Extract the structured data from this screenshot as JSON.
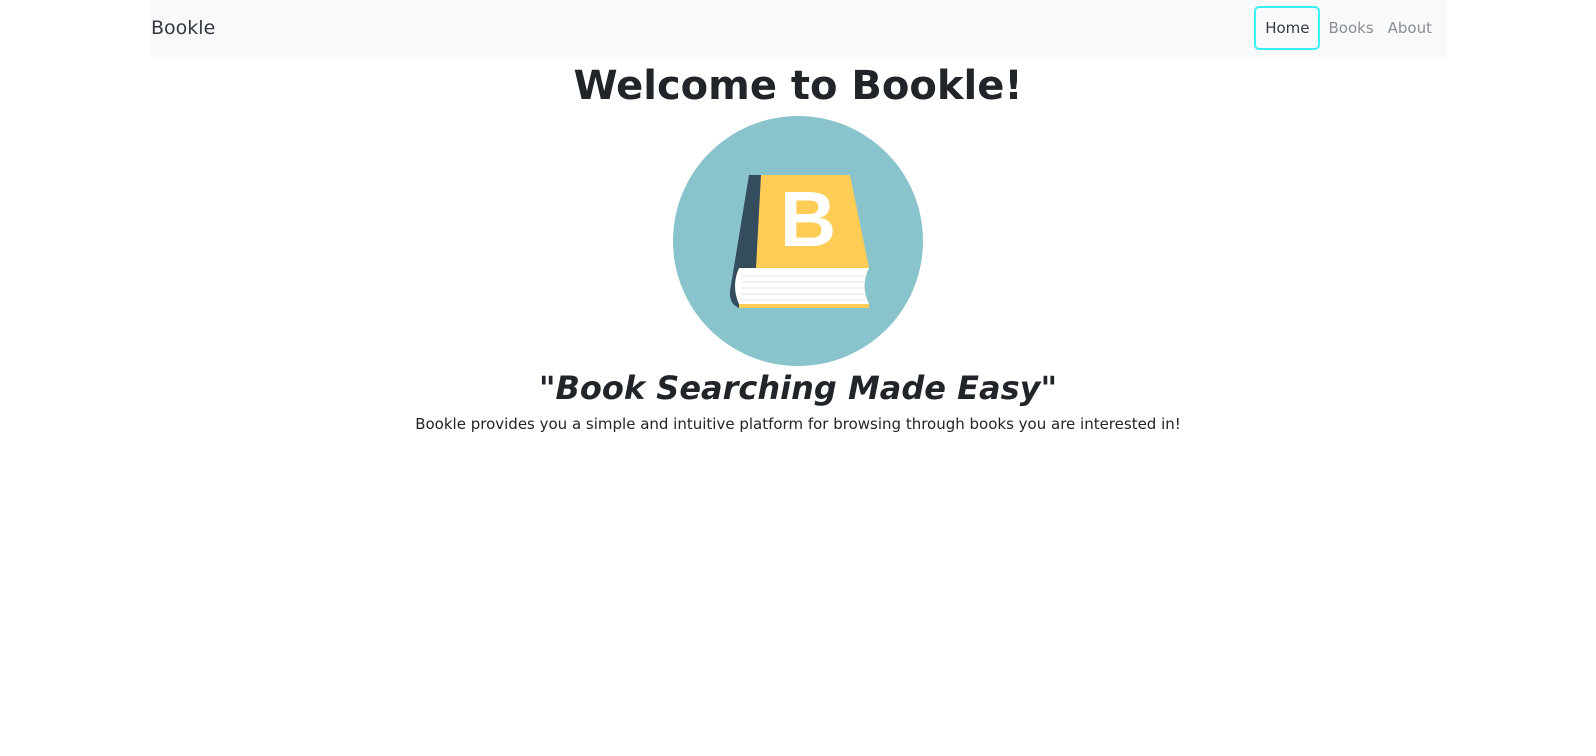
{
  "navbar": {
    "brand": "Bookle",
    "links": [
      {
        "label": "Home",
        "active": true
      },
      {
        "label": "Books",
        "active": false
      },
      {
        "label": "About",
        "active": false
      }
    ]
  },
  "main": {
    "title": "Welcome to Bookle!",
    "logo": {
      "icon": "book-logo-icon",
      "letter": "B",
      "colors": {
        "circle": "#89c4cc",
        "cover": "#ffcd55",
        "spine": "#334d5e",
        "pages": "#ffffff",
        "letter": "#ffffff"
      }
    },
    "tagline_open_quote": "\"",
    "tagline": "Book Searching Made Easy",
    "tagline_close_quote": "\"",
    "description": "Bookle provides you a simple and intuitive platform for browsing through books you are interested in!"
  },
  "colors": {
    "navbar_bg": "#f8f9fa",
    "active_outline": "#3df0f0",
    "link_inactive": "#8a8f94"
  }
}
